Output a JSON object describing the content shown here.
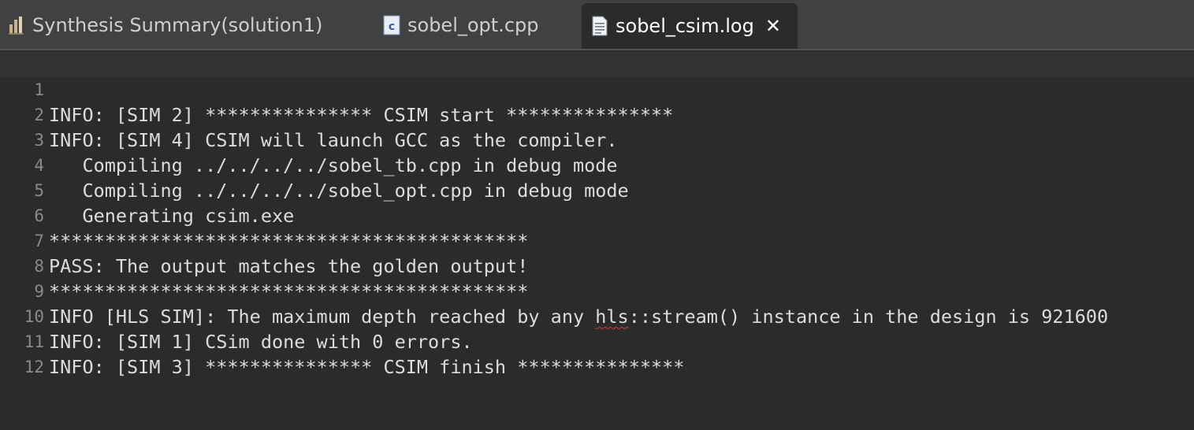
{
  "tabs": [
    {
      "label": "Synthesis Summary(solution1)",
      "icon": "report-icon",
      "active": false
    },
    {
      "label": "sobel_opt.cpp",
      "icon": "cpp-file-icon",
      "active": false
    },
    {
      "label": "sobel_csim.log",
      "icon": "text-file-icon",
      "active": true,
      "close": "✕"
    }
  ],
  "editor": {
    "lines": [
      {
        "num": "1",
        "text": "INFO: [SIM 2] *************** CSIM start ***************"
      },
      {
        "num": "2",
        "text": "INFO: [SIM 4] CSIM will launch GCC as the compiler."
      },
      {
        "num": "3",
        "text": "   Compiling ../../../../sobel_tb.cpp in debug mode"
      },
      {
        "num": "4",
        "text": "   Compiling ../../../../sobel_opt.cpp in debug mode"
      },
      {
        "num": "5",
        "text": "   Generating csim.exe"
      },
      {
        "num": "6",
        "text": "*******************************************"
      },
      {
        "num": "7",
        "text": "PASS: The output matches the golden output!"
      },
      {
        "num": "8",
        "text": "*******************************************"
      },
      {
        "num": "9",
        "pre": "INFO [HLS SIM]: The maximum depth reached by any ",
        "flagged": "hls",
        "post": "::stream() instance in the design is 921600"
      },
      {
        "num": "10",
        "text": "INFO: [SIM 1] CSim done with 0 errors."
      },
      {
        "num": "11",
        "text": "INFO: [SIM 3] *************** CSIM finish ***************"
      },
      {
        "num": "12",
        "text": ""
      }
    ]
  },
  "colors": {
    "background": "#2b2b2b",
    "tabbar": "#3f4143",
    "text": "#dcdcdc",
    "line_numbers": "#8a8a8a",
    "spell_error": "#d04040"
  }
}
